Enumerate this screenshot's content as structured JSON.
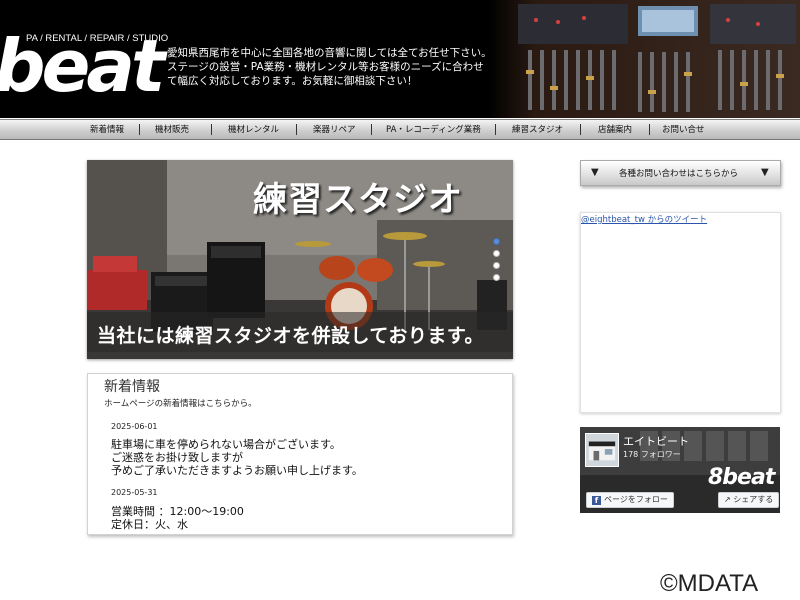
{
  "header": {
    "logo_text": "beat",
    "tagline": "PA / RENTAL / REPAIR / STUDIO",
    "intro_lines": [
      "愛知県西尾市を中心に全国各地の音響に関しては全てお任せ下さい。",
      "ステージの設営・PA業務・機材レンタル等お客様のニーズに合わせ",
      "て幅広く対応しております。お気軽に御相談下さい！"
    ]
  },
  "nav": {
    "items": [
      {
        "label": "新着情報"
      },
      {
        "label": "機材販売"
      },
      {
        "label": "機材レンタル"
      },
      {
        "label": "楽器リペア"
      },
      {
        "label": "PA・レコーディング業務"
      },
      {
        "label": "練習スタジオ"
      },
      {
        "label": "店舗案内"
      },
      {
        "label": "お問い合せ"
      }
    ]
  },
  "slider": {
    "title": "練習スタジオ",
    "caption": "当社には練習スタジオを併設しております。",
    "slide_count": 4,
    "active_slide": 1
  },
  "news": {
    "heading": "新着情報",
    "subtitle": "ホームページの新着情報はこちらから。",
    "entries": [
      {
        "date": "2025-06-01",
        "lines": [
          "駐車場に車を停められない場合がございます。",
          "ご迷惑をお掛け致しますが",
          "予めご了承いただきますようお願い申し上げます。"
        ]
      },
      {
        "date": "2025-05-31",
        "lines": [
          "営業時間 ：12:00～19:00",
          "定休日：火、水"
        ]
      }
    ]
  },
  "sidebar": {
    "contact_label": "各種お問い合わせはこちらから",
    "twitter_link": "@eightbeat_tw からのツイート",
    "facebook": {
      "page_name": "エイトビート",
      "followers": "178 フォロワー",
      "logo_text": "8beat",
      "follow_label": "ページをフォロー",
      "share_label": "シェアする"
    }
  },
  "footer": {
    "copyright": "©MDATA"
  },
  "colors": {
    "header_bg": "#000000",
    "link_blue": "#2a55aa",
    "facebook_blue": "#3b5998",
    "slider_active_dot": "#5a8fd8"
  }
}
